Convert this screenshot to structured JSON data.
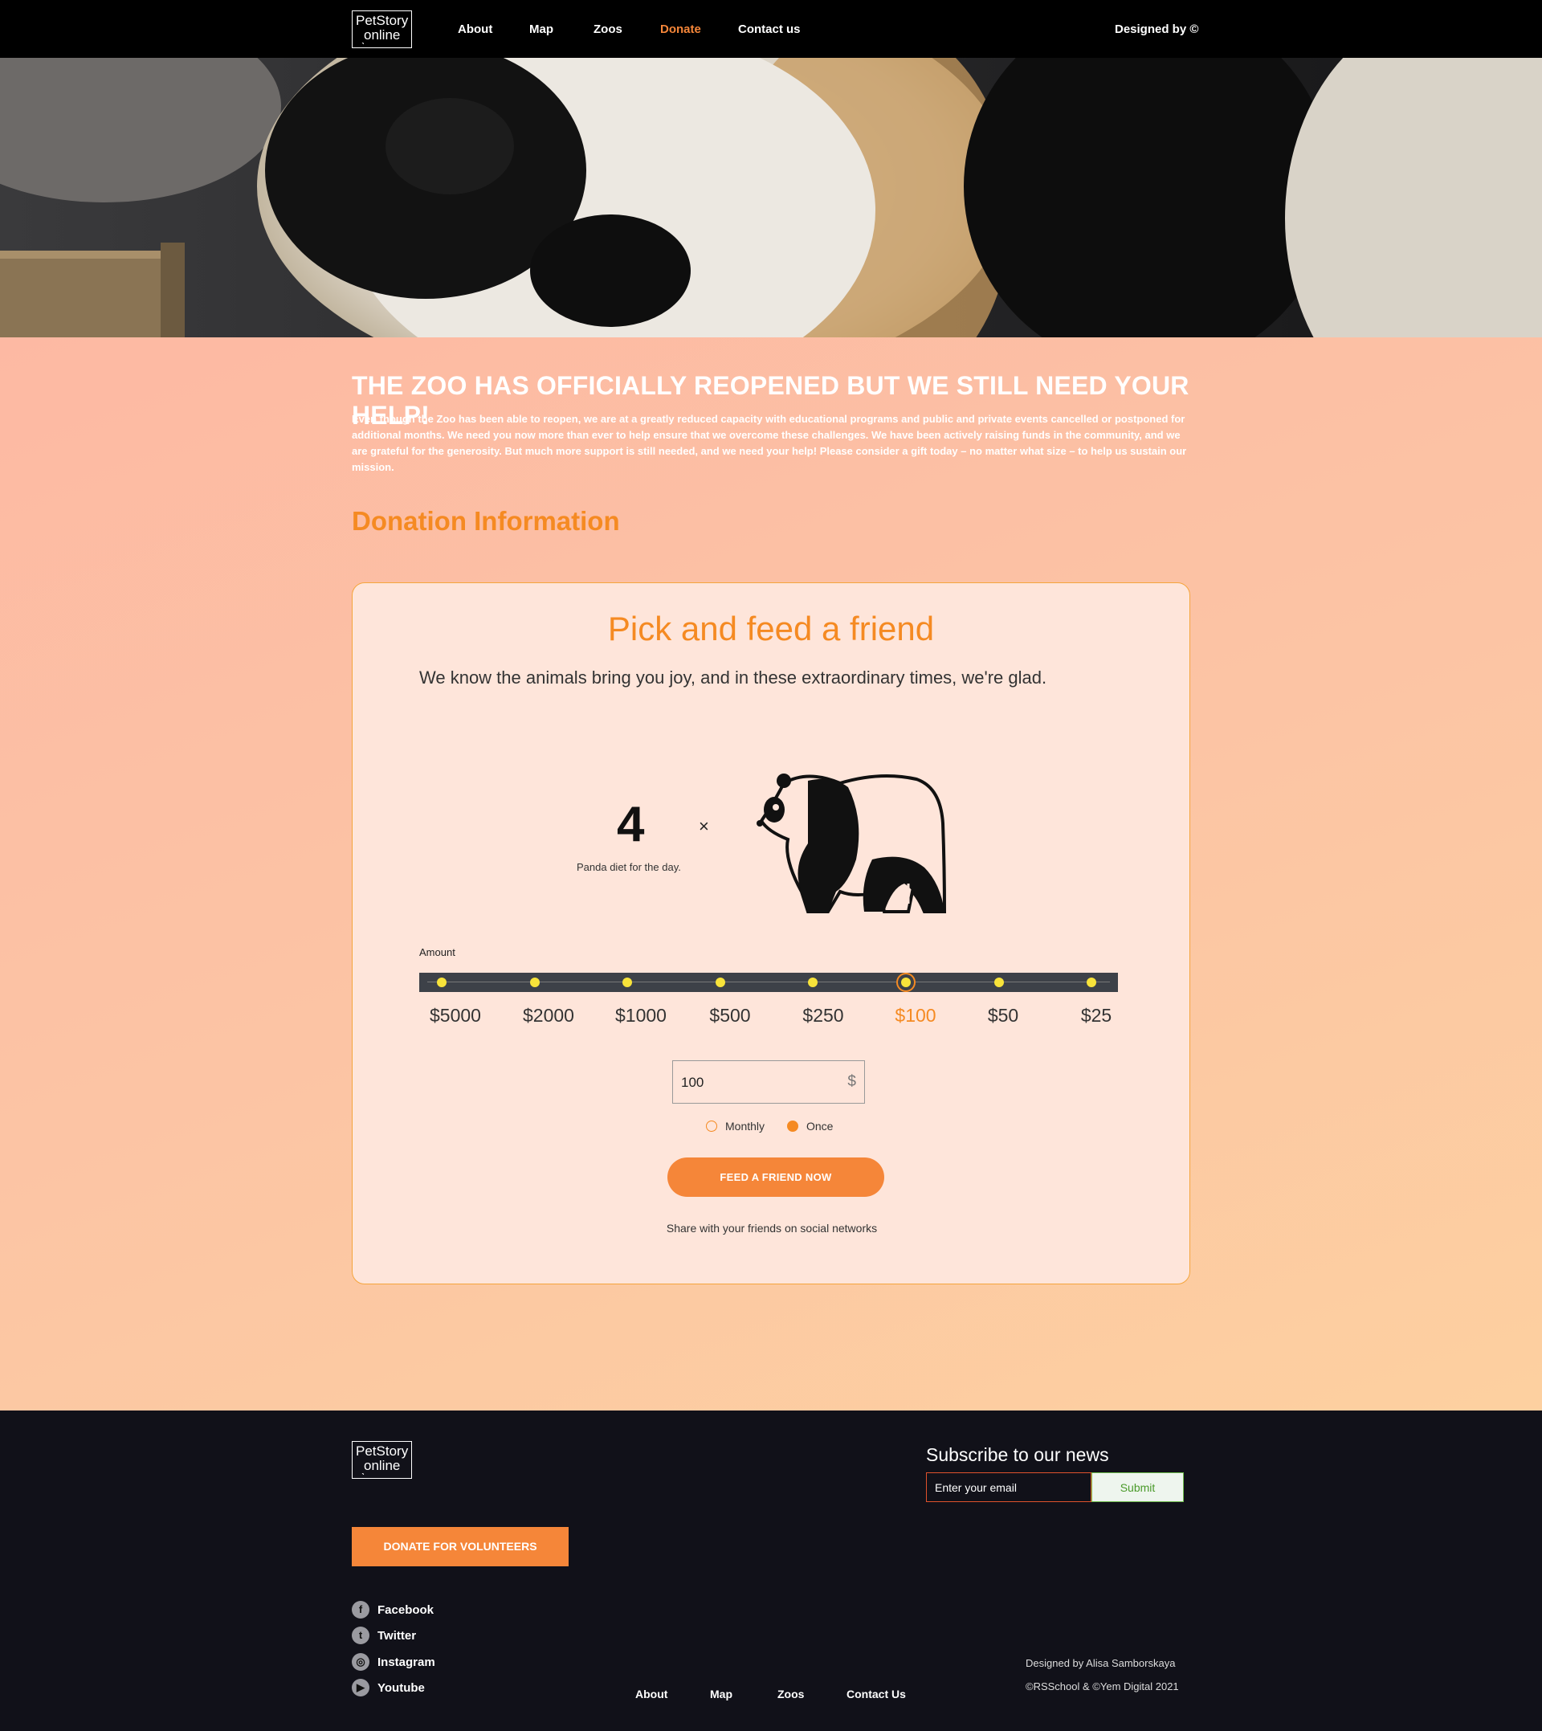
{
  "header": {
    "logo_line1": "PetStory",
    "logo_line2": "online",
    "nav": [
      "About",
      "Map",
      "Zoos",
      "Donate",
      "Contact us"
    ],
    "active_nav": "Donate",
    "designed_by": "Designed by ©"
  },
  "main": {
    "headline": "THE ZOO HAS OFFICIALLY REOPENED BUT WE STILL NEED YOUR HELP!",
    "intro": "Even though the Zoo has been able to reopen, we are at a greatly reduced capacity with educational programs and public and private events cancelled or postponed for additional months. We need you now more than ever to help ensure that we overcome these challenges. We have been actively raising funds in the community, and we are grateful for the generosity. But much more support is still needed, and we need your help! Please consider a gift today – no matter what size – to help us sustain our mission.",
    "section_title": "Donation Information"
  },
  "card": {
    "title": "Pick and feed a friend",
    "subtitle": "We know the animals bring you joy, and in these extraordinary times, we're glad.",
    "count": "4",
    "times": "×",
    "count_caption": "Panda diet for the day.",
    "amount_label": "Amount",
    "amounts": [
      "$5000",
      "$2000",
      "$1000",
      "$500",
      "$250",
      "$100",
      "$50",
      "$25"
    ],
    "selected_amount": "$100",
    "input_value": "100",
    "currency": "$",
    "frequency_options": [
      "Monthly",
      "Once"
    ],
    "selected_frequency": "Once",
    "button": "FEED A FRIEND NOW",
    "share": "Share with your friends on social networks"
  },
  "footer": {
    "logo_line1": "PetStory",
    "logo_line2": "online",
    "volunteer_button": "DONATE FOR VOLUNTEERS",
    "social": [
      {
        "label": "Facebook",
        "icon": "facebook-icon"
      },
      {
        "label": "Twitter",
        "icon": "twitter-icon"
      },
      {
        "label": "Instagram",
        "icon": "instagram-icon"
      },
      {
        "label": "Youtube",
        "icon": "youtube-icon"
      }
    ],
    "subscribe_title": "Subscribe to our news",
    "email_placeholder": "Enter your email",
    "submit": "Submit",
    "nav": [
      "About",
      "Map",
      "Zoos",
      "Contact Us"
    ],
    "credit1": "Designed by Alisa Samborskaya",
    "credit2": "©RSSchool & ©Yem Digital 2021"
  },
  "colors": {
    "accent": "#f58639",
    "accent_text": "#f58a22",
    "dot": "#f8e33a",
    "track": "#3d4148",
    "footer_bg": "#111119"
  }
}
